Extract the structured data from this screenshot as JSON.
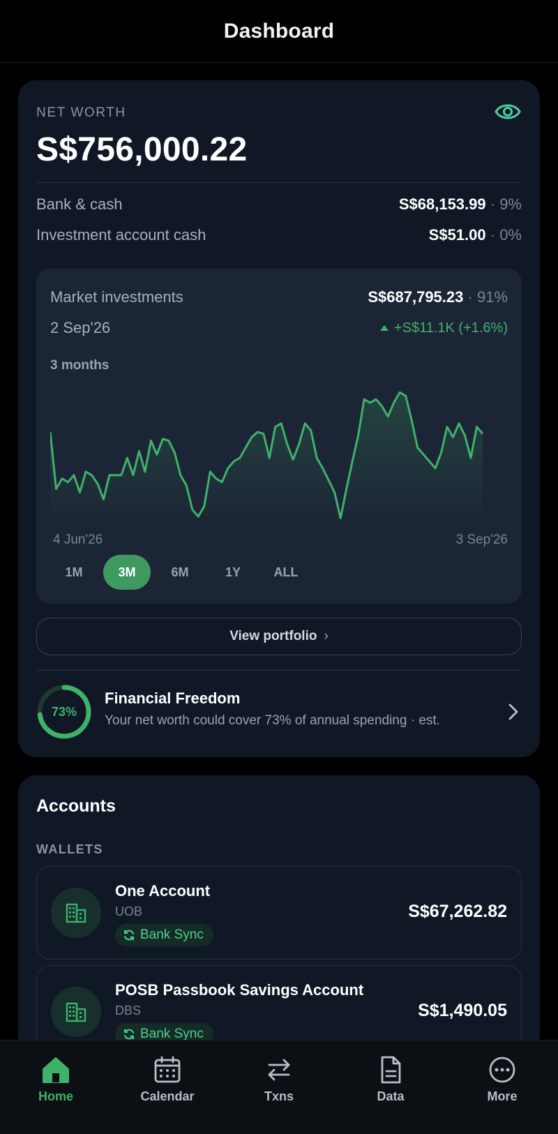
{
  "header": {
    "title": "Dashboard"
  },
  "net_worth": {
    "label": "NET WORTH",
    "value": "S$756,000.22",
    "rows": [
      {
        "label": "Bank & cash",
        "amount": "S$68,153.99",
        "percent": "· 9%"
      },
      {
        "label": "Investment account cash",
        "amount": "S$51.00",
        "percent": "· 0%"
      }
    ]
  },
  "market": {
    "label": "Market investments",
    "amount": "S$687,795.23",
    "percent": "· 91%",
    "date": "2 Sep'26",
    "change": "+S$11.1K (+1.6%)",
    "range_label": "3 months",
    "x_start": "4 Jun'26",
    "x_end": "3 Sep'26",
    "periods": [
      "1M",
      "3M",
      "6M",
      "1Y",
      "ALL"
    ],
    "active_period": "3M"
  },
  "chart_data": {
    "type": "area",
    "color": "#3fb26a",
    "x_range": [
      "4 Jun'26",
      "3 Sep'26"
    ],
    "values": [
      0.45,
      0.12,
      0.18,
      0.16,
      0.2,
      0.1,
      0.22,
      0.2,
      0.15,
      0.06,
      0.2,
      0.2,
      0.2,
      0.3,
      0.2,
      0.34,
      0.22,
      0.4,
      0.32,
      0.41,
      0.4,
      0.33,
      0.2,
      0.14,
      0.0,
      -0.04,
      0.02,
      0.22,
      0.18,
      0.16,
      0.24,
      0.28,
      0.3,
      0.36,
      0.42,
      0.45,
      0.44,
      0.3,
      0.48,
      0.5,
      0.38,
      0.29,
      0.38,
      0.5,
      0.46,
      0.3,
      0.24,
      0.17,
      0.1,
      -0.05,
      0.12,
      0.28,
      0.43,
      0.64,
      0.62,
      0.64,
      0.6,
      0.54,
      0.62,
      0.68,
      0.66,
      0.52,
      0.36,
      0.32,
      0.28,
      0.24,
      0.33,
      0.48,
      0.42,
      0.5,
      0.43,
      0.3,
      0.48,
      0.44
    ],
    "ylim": [
      -0.1,
      0.75
    ]
  },
  "portfolio_button": {
    "label": "View portfolio"
  },
  "freedom": {
    "percent_label": "73%",
    "progress": 0.73,
    "title": "Financial Freedom",
    "subtitle": "Your net worth could cover 73% of annual spending · est."
  },
  "accounts": {
    "title": "Accounts",
    "section": "WALLETS",
    "items": [
      {
        "name": "One Account",
        "bank": "UOB",
        "sync": "Bank Sync",
        "balance": "S$67,262.82"
      },
      {
        "name": "POSB Passbook Savings Account",
        "bank": "DBS",
        "sync": "Bank Sync",
        "balance": "S$1,490.05"
      }
    ]
  },
  "tabs": [
    {
      "label": "Home",
      "icon": "home-icon",
      "active": true
    },
    {
      "label": "Calendar",
      "icon": "calendar-icon",
      "active": false
    },
    {
      "label": "Txns",
      "icon": "transfer-icon",
      "active": false
    },
    {
      "label": "Data",
      "icon": "document-icon",
      "active": false
    },
    {
      "label": "More",
      "icon": "more-icon",
      "active": false
    }
  ],
  "colors": {
    "accent": "#3fb26a",
    "card": "#101826",
    "background": "#000000"
  }
}
